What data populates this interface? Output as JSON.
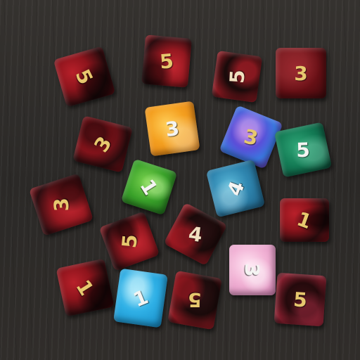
{
  "dice": [
    {
      "name": "die-red-black-5-top-left",
      "value": "5",
      "color": "#8e141c"
    },
    {
      "name": "die-red-black-5-top",
      "value": "5",
      "color": "#951820"
    },
    {
      "name": "die-black-red-5-top",
      "value": "5",
      "color": "#1a0a0a"
    },
    {
      "name": "die-dark-red-3-top-right",
      "value": "3",
      "color": "#6a1016"
    },
    {
      "name": "die-red-black-3",
      "value": "3",
      "color": "#8e141c"
    },
    {
      "name": "die-orange-3",
      "value": "3",
      "color": "#f4a020"
    },
    {
      "name": "die-purple-blue-3",
      "value": "3",
      "color": "#5a4fd8"
    },
    {
      "name": "die-green-teal-5",
      "value": "5",
      "color": "#137a54"
    },
    {
      "name": "die-green-1",
      "value": "1",
      "color": "#3aa22a"
    },
    {
      "name": "die-teal-blue-4",
      "value": "4",
      "color": "#2f86b0"
    },
    {
      "name": "die-red-black-3-left",
      "value": "3",
      "color": "#951820"
    },
    {
      "name": "die-red-black-1-right",
      "value": "1",
      "color": "#8e141c"
    },
    {
      "name": "die-red-black-5-middle",
      "value": "5",
      "color": "#8e141c"
    },
    {
      "name": "die-black-red-4",
      "value": "4",
      "color": "#1a0a0a"
    },
    {
      "name": "die-red-black-1-bottom-left",
      "value": "1",
      "color": "#951820"
    },
    {
      "name": "die-cyan-1",
      "value": "1",
      "color": "#2fb0e6"
    },
    {
      "name": "die-black-red-5-bottom",
      "value": "5",
      "color": "#1a0a0a"
    },
    {
      "name": "die-pink-3",
      "value": "3",
      "color": "#f2b4d6"
    },
    {
      "name": "die-maroon-black-5",
      "value": "5",
      "color": "#240a0c"
    }
  ]
}
